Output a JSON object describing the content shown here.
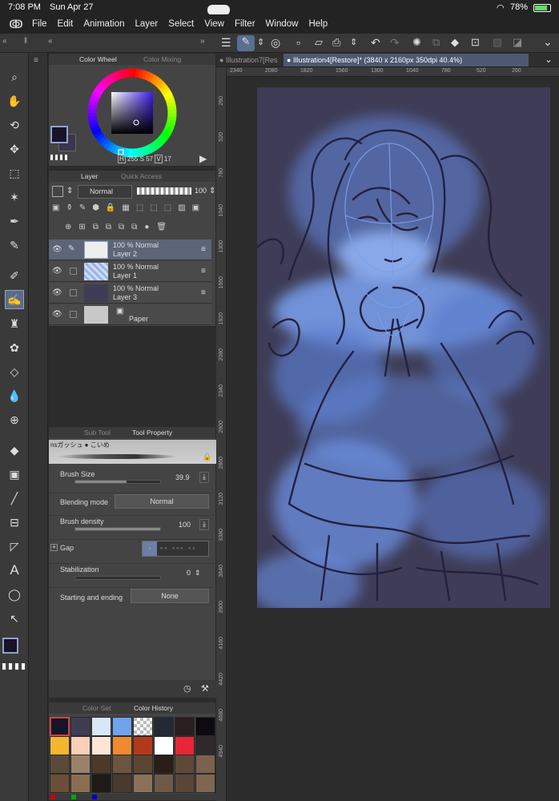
{
  "status": {
    "time": "7:08 PM",
    "date": "Sun Apr 27",
    "battery": "78%"
  },
  "menu": {
    "items": [
      "File",
      "Edit",
      "Animation",
      "Layer",
      "Select",
      "View",
      "Filter",
      "Window",
      "Help"
    ]
  },
  "doc_tabs": [
    {
      "label": "Illustration7[Res",
      "active": false
    },
    {
      "label": "Illustration4[Restore]* (3840 x 2160px 350dpi 40.4%)",
      "active": true
    }
  ],
  "color_panel": {
    "tab1": "Color Wheel",
    "tab2": "Color Mixing",
    "h_label": "H",
    "h": "255",
    "s_label": "S",
    "s": "57",
    "v_label": "V",
    "v": "17",
    "main_color": "#171429",
    "sub_color": "#3a3550"
  },
  "layer_panel": {
    "tab1": "Layer",
    "tab2": "Quick Access",
    "blend": "Normal",
    "opacity": "100",
    "layers": [
      {
        "pct": "100 % Normal",
        "name": "Layer 2",
        "selected": true
      },
      {
        "pct": "100 % Normal",
        "name": "Layer 1",
        "selected": false
      },
      {
        "pct": "100 % Normal",
        "name": "Layer 3",
        "selected": false
      },
      {
        "pct": "",
        "name": "Paper",
        "selected": false
      }
    ]
  },
  "tool_panel": {
    "tab1": "Sub Tool",
    "tab2": "Tool Property",
    "brush_name": "nsガッシュ ● こいめ",
    "brush_size_label": "Brush Size",
    "brush_size": "39.9",
    "blending_label": "Blending mode",
    "blending": "Normal",
    "density_label": "Brush density",
    "density": "100",
    "gap_label": "Gap",
    "stabilization_label": "Stabilization",
    "stabilization": "0",
    "start_end_label": "Starting and ending",
    "start_end": "None",
    "brush_size_fill": 0.6,
    "density_fill": 1.0,
    "stabilization_fill": 0.0
  },
  "color_history": {
    "tab1": "Color Set",
    "tab2": "Color History",
    "swatches": [
      "#171429",
      "#3e3d52",
      "#d9e6f5",
      "#6fa3ec",
      "checker",
      "#232a36",
      "#2a1e1e",
      "#0d0b10",
      "#f2b630",
      "#f8d0b8",
      "#fbe6d6",
      "#f08a2e",
      "#b23a1c",
      "#ffffff",
      "#e8263a",
      "#2e2a2a",
      "#5a4a3a",
      "#9a826a",
      "#4a3a2a",
      "#6b5440",
      "#5c4632",
      "#2a1e18",
      "#5e4838",
      "#7a624c",
      "#6a4e38",
      "#8a6e52",
      "#1e1a18",
      "#4a3a2e",
      "#8a7258",
      "#6e5a48",
      "#5a4636",
      "#7e6650"
    ]
  },
  "canvas": {
    "bg": "#3e3c56",
    "light": "#6f96e8",
    "line": "#22203a"
  },
  "ruler_top": [
    "2340",
    "2080",
    "1820",
    "1560",
    "1300",
    "1040",
    "780",
    "520",
    "260"
  ],
  "ruler_left": [
    "260",
    "520",
    "780",
    "1040",
    "1300",
    "1560",
    "1820",
    "2080",
    "2340",
    "2600",
    "2860",
    "3120",
    "3380",
    "3640",
    "3900",
    "4160",
    "4420",
    "4680",
    "4940"
  ]
}
